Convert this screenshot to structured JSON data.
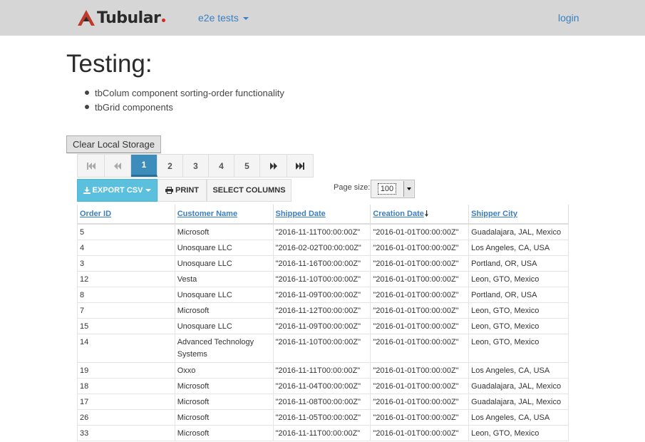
{
  "navbar": {
    "brand": "Tubular",
    "menu_label": "e2e tests",
    "login_label": "login"
  },
  "page": {
    "title": "Testing:",
    "bullets": [
      "tbColum component sorting-order functionality",
      "tbGrid components"
    ],
    "clear_button": "Clear Local Storage"
  },
  "pager": {
    "pages": [
      "1",
      "2",
      "3",
      "4",
      "5"
    ],
    "active_page": "1"
  },
  "toolbar": {
    "export_label": "EXPORT CSV",
    "print_label": "PRINT",
    "select_columns_label": "SELECT COLUMNS"
  },
  "page_size": {
    "label": "Page size:",
    "value": "100"
  },
  "grid": {
    "columns": [
      "Order ID",
      "Customer Name",
      "Shipped Date",
      "Creation Date",
      "Shipper City"
    ],
    "sorted_column": "Creation Date",
    "sort_direction": "descending",
    "rows": [
      [
        "5",
        "Microsoft",
        "\"2016-11-11T00:00:00Z\"",
        "\"2016-01-01T00:00:00Z\"",
        "Guadalajara, JAL, Mexico"
      ],
      [
        "4",
        "Unosquare LLC",
        "\"2016-02-02T00:00:00Z\"",
        "\"2016-01-01T00:00:00Z\"",
        "Los Angeles, CA, USA"
      ],
      [
        "3",
        "Unosquare LLC",
        "\"2016-11-16T00:00:00Z\"",
        "\"2016-01-01T00:00:00Z\"",
        "Portland, OR, USA"
      ],
      [
        "12",
        "Vesta",
        "\"2016-11-10T00:00:00Z\"",
        "\"2016-01-01T00:00:00Z\"",
        "Leon, GTO, Mexico"
      ],
      [
        "8",
        "Unosquare LLC",
        "\"2016-11-09T00:00:00Z\"",
        "\"2016-01-01T00:00:00Z\"",
        "Portland, OR, USA"
      ],
      [
        "7",
        "Microsoft",
        "\"2016-11-12T00:00:00Z\"",
        "\"2016-01-01T00:00:00Z\"",
        "Leon, GTO, Mexico"
      ],
      [
        "15",
        "Unosquare LLC",
        "\"2016-11-09T00:00:00Z\"",
        "\"2016-01-01T00:00:00Z\"",
        "Leon, GTO, Mexico"
      ],
      [
        "14",
        "Advanced Technology Systems",
        "\"2016-11-10T00:00:00Z\"",
        "\"2016-01-01T00:00:00Z\"",
        "Leon, GTO, Mexico"
      ],
      [
        "19",
        "Oxxo",
        "\"2016-11-11T00:00:00Z\"",
        "\"2016-01-01T00:00:00Z\"",
        "Los Angeles, CA, USA"
      ],
      [
        "18",
        "Microsoft",
        "\"2016-11-04T00:00:00Z\"",
        "\"2016-01-01T00:00:00Z\"",
        "Guadalajara, JAL, Mexico"
      ],
      [
        "17",
        "Microsoft",
        "\"2016-11-08T00:00:00Z\"",
        "\"2016-01-01T00:00:00Z\"",
        "Guadalajara, JAL, Mexico"
      ],
      [
        "26",
        "Microsoft",
        "\"2016-11-05T00:00:00Z\"",
        "\"2016-01-01T00:00:00Z\"",
        "Los Angeles, CA, USA"
      ],
      [
        "33",
        "Microsoft",
        "\"2016-11-11T00:00:00Z\"",
        "\"2016-01-01T00:00:00Z\"",
        "Leon, GTO, Mexico"
      ]
    ]
  }
}
